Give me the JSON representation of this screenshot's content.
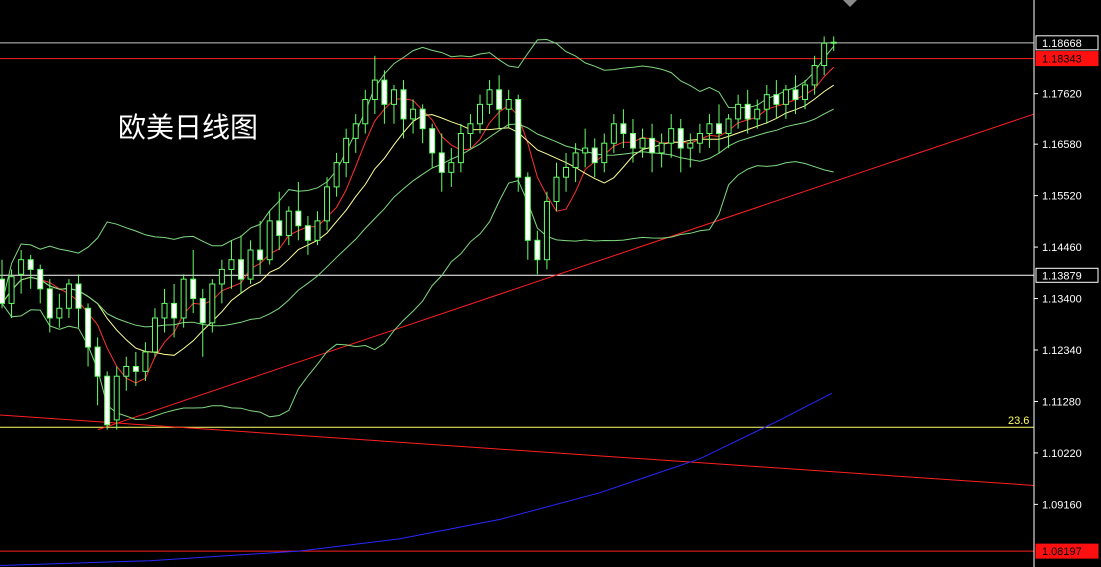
{
  "chart_data": {
    "type": "candlestick",
    "title": "欧美日线图",
    "ylim": [
      1.0787,
      1.1955
    ],
    "y_ticks": [
      "1.17620",
      "1.16580",
      "1.15520",
      "1.14460",
      "1.13400",
      "1.12340",
      "1.11280",
      "1.10220",
      "1.09160"
    ],
    "price_tags": [
      {
        "text": "1.18668",
        "value": 1.18668,
        "style": "white-box",
        "line_color": "#c8c8c8",
        "line_from": 0
      },
      {
        "text": "1.18343",
        "value": 1.18343,
        "style": "red-box",
        "line_color": "#ff2020",
        "line_from": 0
      },
      {
        "text": "1.13879",
        "value": 1.13879,
        "style": "white-box",
        "line_color": "#ffffff",
        "line_from": 0
      },
      {
        "text": "1.08197",
        "value": 1.08197,
        "style": "red-box",
        "line_color": "#ff2020",
        "line_from": 0
      }
    ],
    "fib_level": {
      "label": "23.6",
      "value": 1.1075,
      "color": "#ffff66"
    },
    "trendlines": [
      {
        "color": "#ff2020",
        "from": [
          0,
          1.11
        ],
        "to": [
          1034,
          1.0955
        ]
      },
      {
        "color": "#ff2020",
        "from": [
          98,
          1.107
        ],
        "to": [
          1034,
          1.172
        ]
      }
    ],
    "candles": [
      [
        1.138,
        1.142,
        1.133,
        1.132
      ],
      [
        1.133,
        1.14,
        1.1385,
        1.13
      ],
      [
        1.139,
        1.144,
        1.142,
        1.135
      ],
      [
        1.142,
        1.143,
        1.14,
        1.136
      ],
      [
        1.14,
        1.141,
        1.136,
        1.133
      ],
      [
        1.136,
        1.138,
        1.13,
        1.127
      ],
      [
        1.13,
        1.135,
        1.132,
        1.128
      ],
      [
        1.132,
        1.138,
        1.137,
        1.13
      ],
      [
        1.137,
        1.139,
        1.132,
        1.128
      ],
      [
        1.132,
        1.133,
        1.124,
        1.12
      ],
      [
        1.124,
        1.126,
        1.118,
        1.112
      ],
      [
        1.118,
        1.119,
        1.108,
        1.107
      ],
      [
        1.109,
        1.12,
        1.118,
        1.107
      ],
      [
        1.118,
        1.122,
        1.12,
        1.115
      ],
      [
        1.12,
        1.123,
        1.119,
        1.116
      ],
      [
        1.119,
        1.125,
        1.123,
        1.117
      ],
      [
        1.123,
        1.132,
        1.13,
        1.122
      ],
      [
        1.13,
        1.136,
        1.133,
        1.127
      ],
      [
        1.133,
        1.137,
        1.13,
        1.126
      ],
      [
        1.13,
        1.139,
        1.138,
        1.128
      ],
      [
        1.138,
        1.144,
        1.134,
        1.131
      ],
      [
        1.134,
        1.136,
        1.129,
        1.122
      ],
      [
        1.129,
        1.138,
        1.137,
        1.127
      ],
      [
        1.137,
        1.142,
        1.14,
        1.133
      ],
      [
        1.14,
        1.146,
        1.142,
        1.136
      ],
      [
        1.142,
        1.147,
        1.138,
        1.135
      ],
      [
        1.138,
        1.146,
        1.144,
        1.137
      ],
      [
        1.144,
        1.15,
        1.142,
        1.139
      ],
      [
        1.142,
        1.152,
        1.15,
        1.141
      ],
      [
        1.15,
        1.156,
        1.147,
        1.144
      ],
      [
        1.147,
        1.153,
        1.152,
        1.145
      ],
      [
        1.152,
        1.158,
        1.149,
        1.146
      ],
      [
        1.149,
        1.151,
        1.146,
        1.143
      ],
      [
        1.146,
        1.152,
        1.15,
        1.145
      ],
      [
        1.15,
        1.159,
        1.157,
        1.148
      ],
      [
        1.157,
        1.164,
        1.162,
        1.155
      ],
      [
        1.162,
        1.169,
        1.167,
        1.159
      ],
      [
        1.167,
        1.172,
        1.17,
        1.164
      ],
      [
        1.17,
        1.177,
        1.175,
        1.168
      ],
      [
        1.175,
        1.184,
        1.179,
        1.172
      ],
      [
        1.179,
        1.181,
        1.174,
        1.17
      ],
      [
        1.174,
        1.178,
        1.177,
        1.17
      ],
      [
        1.177,
        1.179,
        1.171,
        1.167
      ],
      [
        1.171,
        1.175,
        1.173,
        1.168
      ],
      [
        1.173,
        1.174,
        1.169,
        1.166
      ],
      [
        1.169,
        1.17,
        1.164,
        1.161
      ],
      [
        1.164,
        1.168,
        1.16,
        1.156
      ],
      [
        1.16,
        1.165,
        1.162,
        1.157
      ],
      [
        1.162,
        1.17,
        1.168,
        1.16
      ],
      [
        1.168,
        1.172,
        1.17,
        1.165
      ],
      [
        1.17,
        1.176,
        1.174,
        1.168
      ],
      [
        1.174,
        1.179,
        1.177,
        1.172
      ],
      [
        1.177,
        1.18,
        1.173,
        1.169
      ],
      [
        1.173,
        1.177,
        1.175,
        1.169
      ],
      [
        1.175,
        1.176,
        1.159,
        1.156
      ],
      [
        1.159,
        1.16,
        1.146,
        1.142
      ],
      [
        1.146,
        1.148,
        1.142,
        1.139
      ],
      [
        1.142,
        1.156,
        1.154,
        1.14
      ],
      [
        1.154,
        1.162,
        1.159,
        1.152
      ],
      [
        1.159,
        1.164,
        1.161,
        1.156
      ],
      [
        1.161,
        1.166,
        1.164,
        1.158
      ],
      [
        1.164,
        1.169,
        1.165,
        1.161
      ],
      [
        1.165,
        1.167,
        1.162,
        1.159
      ],
      [
        1.162,
        1.168,
        1.166,
        1.16
      ],
      [
        1.166,
        1.172,
        1.17,
        1.164
      ],
      [
        1.17,
        1.173,
        1.168,
        1.165
      ],
      [
        1.168,
        1.171,
        1.165,
        1.162
      ],
      [
        1.165,
        1.169,
        1.167,
        1.163
      ],
      [
        1.167,
        1.17,
        1.164,
        1.16
      ],
      [
        1.164,
        1.168,
        1.166,
        1.161
      ],
      [
        1.166,
        1.172,
        1.169,
        1.163
      ],
      [
        1.169,
        1.171,
        1.165,
        1.16
      ],
      [
        1.165,
        1.168,
        1.166,
        1.161
      ],
      [
        1.166,
        1.17,
        1.168,
        1.164
      ],
      [
        1.168,
        1.172,
        1.17,
        1.165
      ],
      [
        1.17,
        1.174,
        1.168,
        1.164
      ],
      [
        1.168,
        1.172,
        1.171,
        1.165
      ],
      [
        1.171,
        1.176,
        1.174,
        1.169
      ],
      [
        1.174,
        1.177,
        1.171,
        1.168
      ],
      [
        1.171,
        1.175,
        1.173,
        1.169
      ],
      [
        1.173,
        1.178,
        1.176,
        1.17
      ],
      [
        1.176,
        1.179,
        1.174,
        1.171
      ],
      [
        1.174,
        1.178,
        1.177,
        1.171
      ],
      [
        1.177,
        1.18,
        1.175,
        1.172
      ],
      [
        1.175,
        1.179,
        1.178,
        1.173
      ],
      [
        1.178,
        1.184,
        1.182,
        1.176
      ],
      [
        1.182,
        1.188,
        1.1866,
        1.18
      ],
      [
        1.1866,
        1.188,
        1.1868,
        1.185
      ]
    ],
    "candle_style": {
      "up_fill": "#000000",
      "up_stroke": "#66ff66",
      "down_fill": "#ffffff",
      "down_stroke": "#66ff66",
      "wick": "#66ff66"
    },
    "moving_averages": [
      {
        "color": "#ff3030",
        "period": 5
      },
      {
        "color": "#ffff99",
        "period": 10
      },
      {
        "color": "#7fd97f",
        "period": 20
      }
    ],
    "bollinger": {
      "color": "#7fd97f",
      "period": 20,
      "k": 2
    },
    "long_ma": {
      "color": "#2828ff",
      "points": [
        [
          0,
          1.079
        ],
        [
          150,
          1.08
        ],
        [
          300,
          1.082
        ],
        [
          400,
          1.0845
        ],
        [
          500,
          1.0885
        ],
        [
          600,
          1.094
        ],
        [
          700,
          1.101
        ],
        [
          780,
          1.109
        ],
        [
          832,
          1.1145
        ]
      ]
    }
  }
}
